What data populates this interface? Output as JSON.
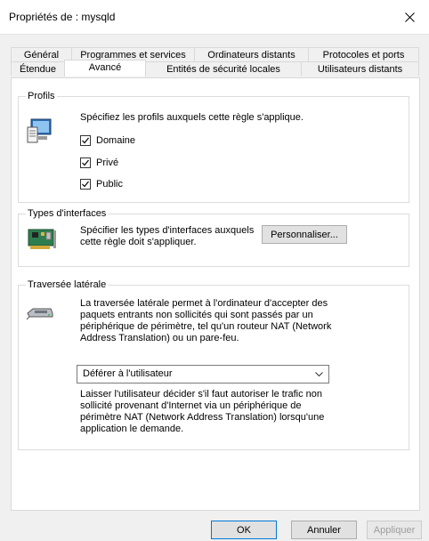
{
  "window": {
    "title": "Propriétés de : mysqld"
  },
  "tabs": {
    "back": [
      "Général",
      "Programmes et services",
      "Ordinateurs distants",
      "Protocoles et ports"
    ],
    "front": [
      "Étendue",
      "Avancé",
      "Entités de sécurité locales",
      "Utilisateurs distants"
    ],
    "active": "Avancé"
  },
  "profiles": {
    "legend": "Profils",
    "description": "Spécifiez les profils auxquels cette règle s'applique.",
    "items": [
      {
        "label": "Domaine",
        "checked": true
      },
      {
        "label": "Privé",
        "checked": true
      },
      {
        "label": "Public",
        "checked": true
      }
    ]
  },
  "interfaces": {
    "legend": "Types d'interfaces",
    "description_line1": "Spécifier les types d'interfaces auxquels",
    "description_line2": "cette règle doit s'appliquer.",
    "customize_label": "Personnaliser..."
  },
  "edge": {
    "legend": "Traversée latérale",
    "description_lines": [
      "La traversée latérale permet à l'ordinateur d'accepter des",
      "paquets entrants non sollicités qui sont passés par un",
      "périphérique de périmètre, tel qu'un routeur NAT (Network",
      "Address Translation) ou un pare-feu."
    ],
    "select_value": "Déférer à l'utilisateur",
    "help_lines": [
      "Laisser l'utilisateur décider s'il faut autoriser le trafic non",
      "sollicité provenant d'Internet via un périphérique de",
      "périmètre NAT (Network Address Translation) lorsqu'une",
      "application le demande."
    ]
  },
  "footer": {
    "ok": "OK",
    "cancel": "Annuler",
    "apply": "Appliquer"
  }
}
